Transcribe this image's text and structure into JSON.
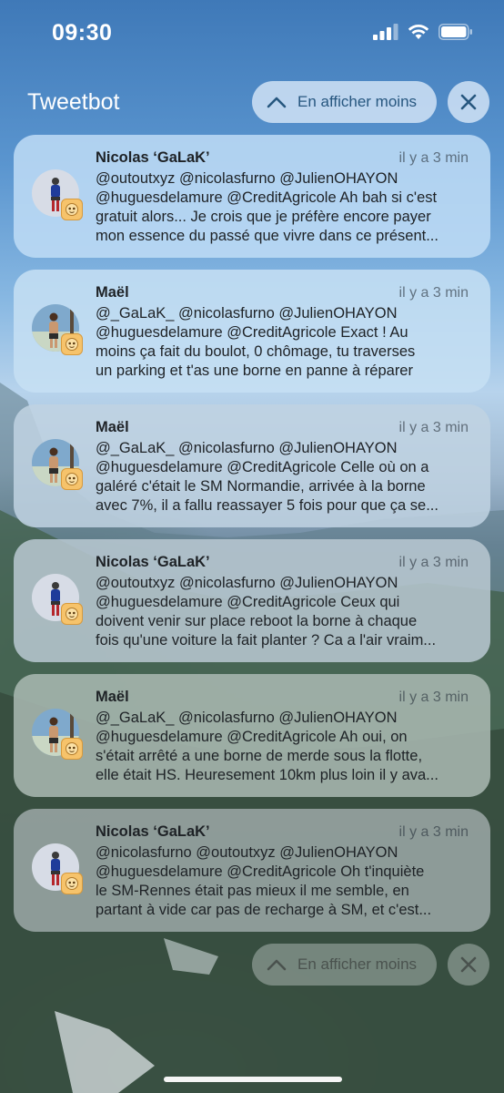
{
  "status_bar": {
    "time": "09:30",
    "icons": [
      "cellular-signal-icon",
      "wifi-icon",
      "battery-icon"
    ]
  },
  "header": {
    "app_name": "Tweetbot",
    "collapse_label": "En afficher moins",
    "collapse_icon": "chevron-up-icon",
    "close_icon": "close-icon"
  },
  "notifications": [
    {
      "author": "Nicolas ‘GaLaK’",
      "time": "il y a 3 min",
      "lines": [
        "@outoutxyz @nicolasfurno @JulienOHAYON",
        "@huguesdelamure @CreditAgricole Ah bah si c'est",
        "gratuit alors... Je crois que je préfère encore payer",
        "mon essence du passé que vivre dans ce présent..."
      ]
    },
    {
      "author": "Maël",
      "time": "il y a 3 min",
      "lines": [
        "@_GaLaK_ @nicolasfurno @JulienOHAYON",
        "@huguesdelamure @CreditAgricole Exact ! Au",
        "moins ça fait du boulot, 0 chômage, tu traverses",
        "un parking et t'as une borne en panne à réparer"
      ]
    },
    {
      "author": "Maël",
      "time": "il y a 3 min",
      "lines": [
        "@_GaLaK_ @nicolasfurno @JulienOHAYON",
        "@huguesdelamure @CreditAgricole Celle où on a",
        "galéré c'était le SM Normandie, arrivée à la borne",
        "avec 7%, il a fallu reassayer 5 fois pour que ça se..."
      ]
    },
    {
      "author": "Nicolas ‘GaLaK’",
      "time": "il y a 3 min",
      "lines": [
        "@outoutxyz @nicolasfurno @JulienOHAYON",
        "@huguesdelamure @CreditAgricole Ceux qui",
        "doivent venir sur place reboot la borne à chaque",
        "fois qu'une voiture la fait planter ? Ca a l'air vraim..."
      ]
    },
    {
      "author": "Maël",
      "time": "il y a 3 min",
      "lines": [
        "@_GaLaK_ @nicolasfurno @JulienOHAYON",
        "@huguesdelamure @CreditAgricole Ah oui, on",
        "s'était arrêté a une borne de merde sous la flotte,",
        "elle était HS. Heuresement 10km plus loin il y ava..."
      ]
    },
    {
      "author": "Nicolas ‘GaLaK’",
      "time": "il y a 3 min",
      "lines": [
        "@nicolasfurno @outoutxyz @JulienOHAYON",
        "@huguesdelamure @CreditAgricole Oh t'inquiète",
        "le SM-Rennes était pas mieux il me semble, en",
        "partant à vide car pas de recharge à SM, et c'est..."
      ]
    }
  ],
  "footer": {
    "collapse_label": "En afficher moins",
    "collapse_icon": "chevron-up-icon",
    "close_icon": "close-icon"
  },
  "colors": {
    "accent": "#27577f",
    "card_tints": [
      "#bfdcf6",
      "#c6dff3",
      "#c0d3e2",
      "#b9c8d2",
      "#aab9b2",
      "#9ca8a6"
    ]
  }
}
